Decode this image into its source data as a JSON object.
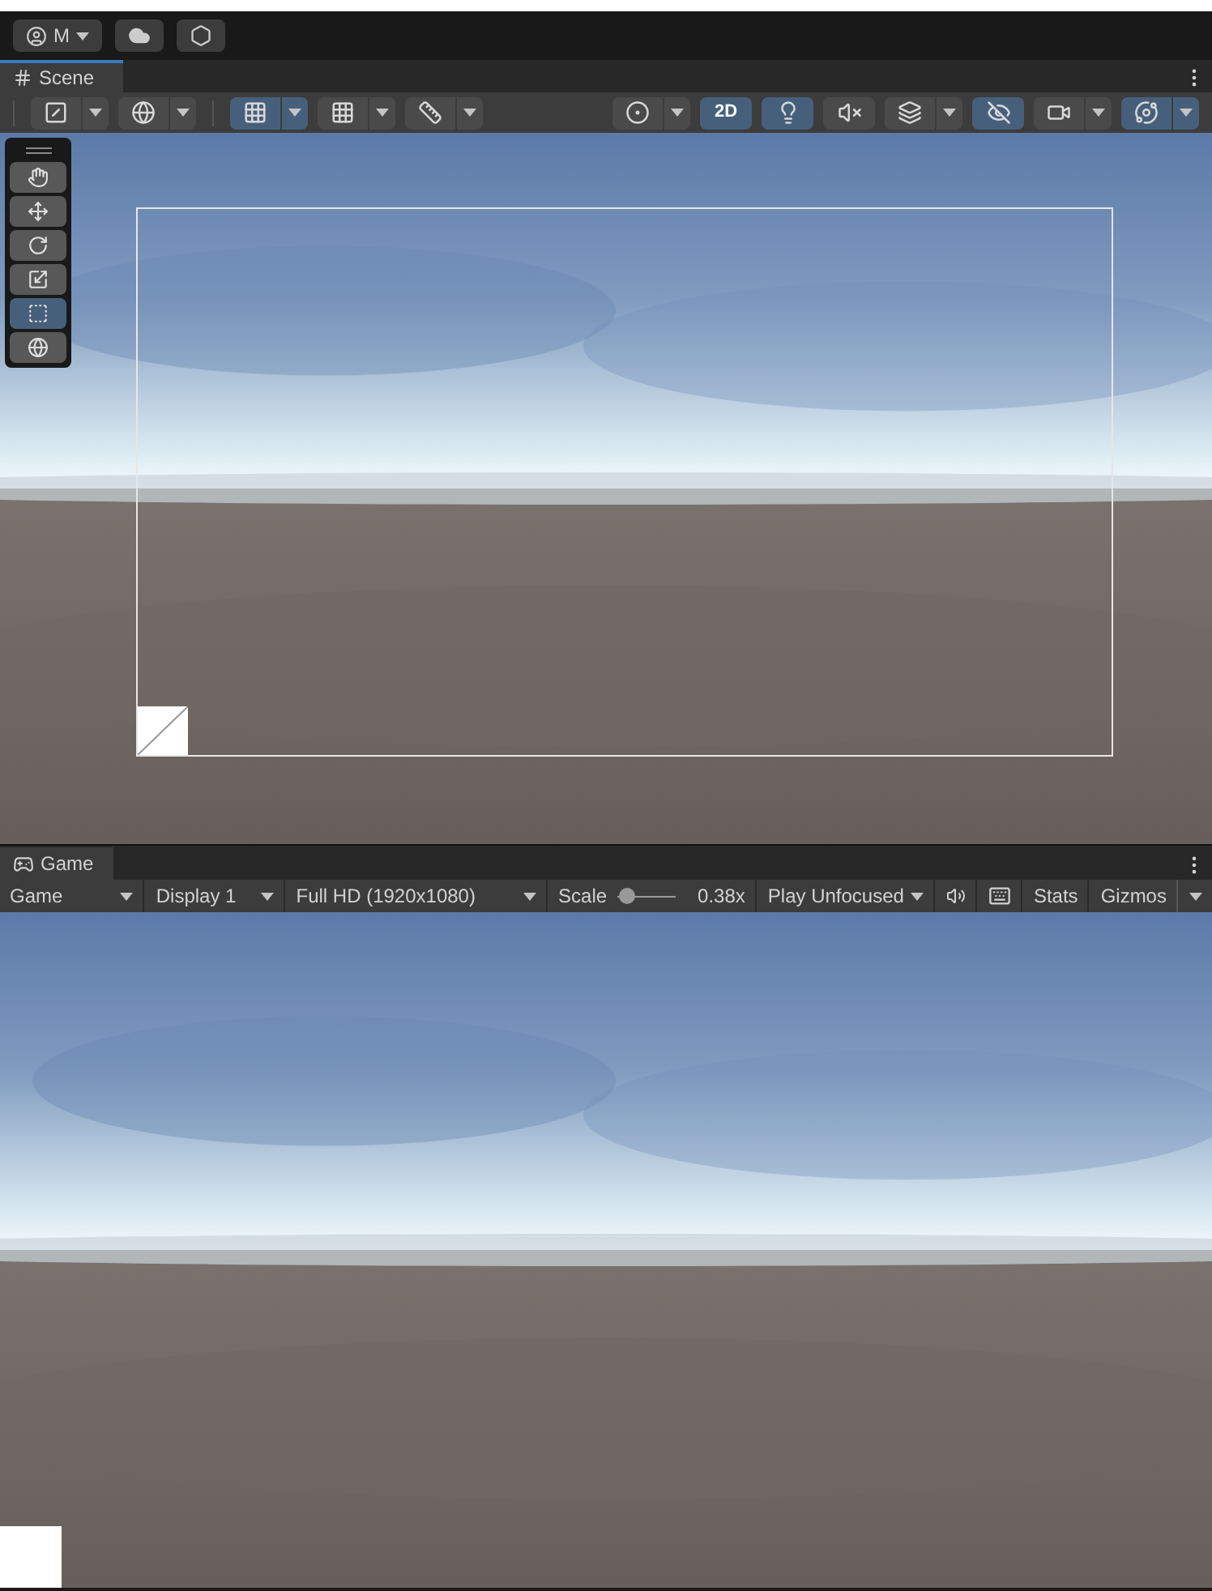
{
  "account": {
    "initial": "M"
  },
  "scene": {
    "title": "Scene",
    "left_tools": [
      {
        "kind": "draw-mode",
        "on": false,
        "dropdown": true
      },
      {
        "kind": "globe",
        "on": false,
        "dropdown": true
      },
      {
        "kind": "grid-snap",
        "on": true,
        "dropdown": true
      },
      {
        "kind": "increment-snap",
        "on": false,
        "dropdown": true
      },
      {
        "kind": "ruler",
        "on": false,
        "dropdown": true
      }
    ],
    "right_tools": [
      {
        "kind": "shading",
        "on": false,
        "dropdown": true
      },
      {
        "kind": "text",
        "label": "2D",
        "on": true,
        "dropdown": false
      },
      {
        "kind": "lighting",
        "on": true,
        "dropdown": false
      },
      {
        "kind": "audio",
        "on": false,
        "dropdown": false
      },
      {
        "kind": "effects",
        "on": false,
        "dropdown": true
      },
      {
        "kind": "visibility",
        "on": true,
        "dropdown": false
      },
      {
        "kind": "camera",
        "on": false,
        "dropdown": true
      },
      {
        "kind": "gizmos",
        "on": true,
        "dropdown": true
      }
    ],
    "tools": [
      {
        "kind": "hand",
        "selected": false
      },
      {
        "kind": "move",
        "selected": false
      },
      {
        "kind": "rotate",
        "selected": false
      },
      {
        "kind": "scale",
        "selected": false
      },
      {
        "kind": "rect",
        "selected": true
      },
      {
        "kind": "transform",
        "selected": false
      }
    ]
  },
  "game": {
    "title": "Game",
    "view_dropdown": "Game",
    "display_dropdown": "Display 1",
    "resolution_dropdown": "Full HD (1920x1080)",
    "scale": {
      "label": "Scale",
      "level": 0.05,
      "reading": "0.38x"
    },
    "play_mode_dropdown": "Play Unfocused",
    "audio_muted": false,
    "stats_button": "Stats",
    "gizmos_button": "Gizmos"
  }
}
